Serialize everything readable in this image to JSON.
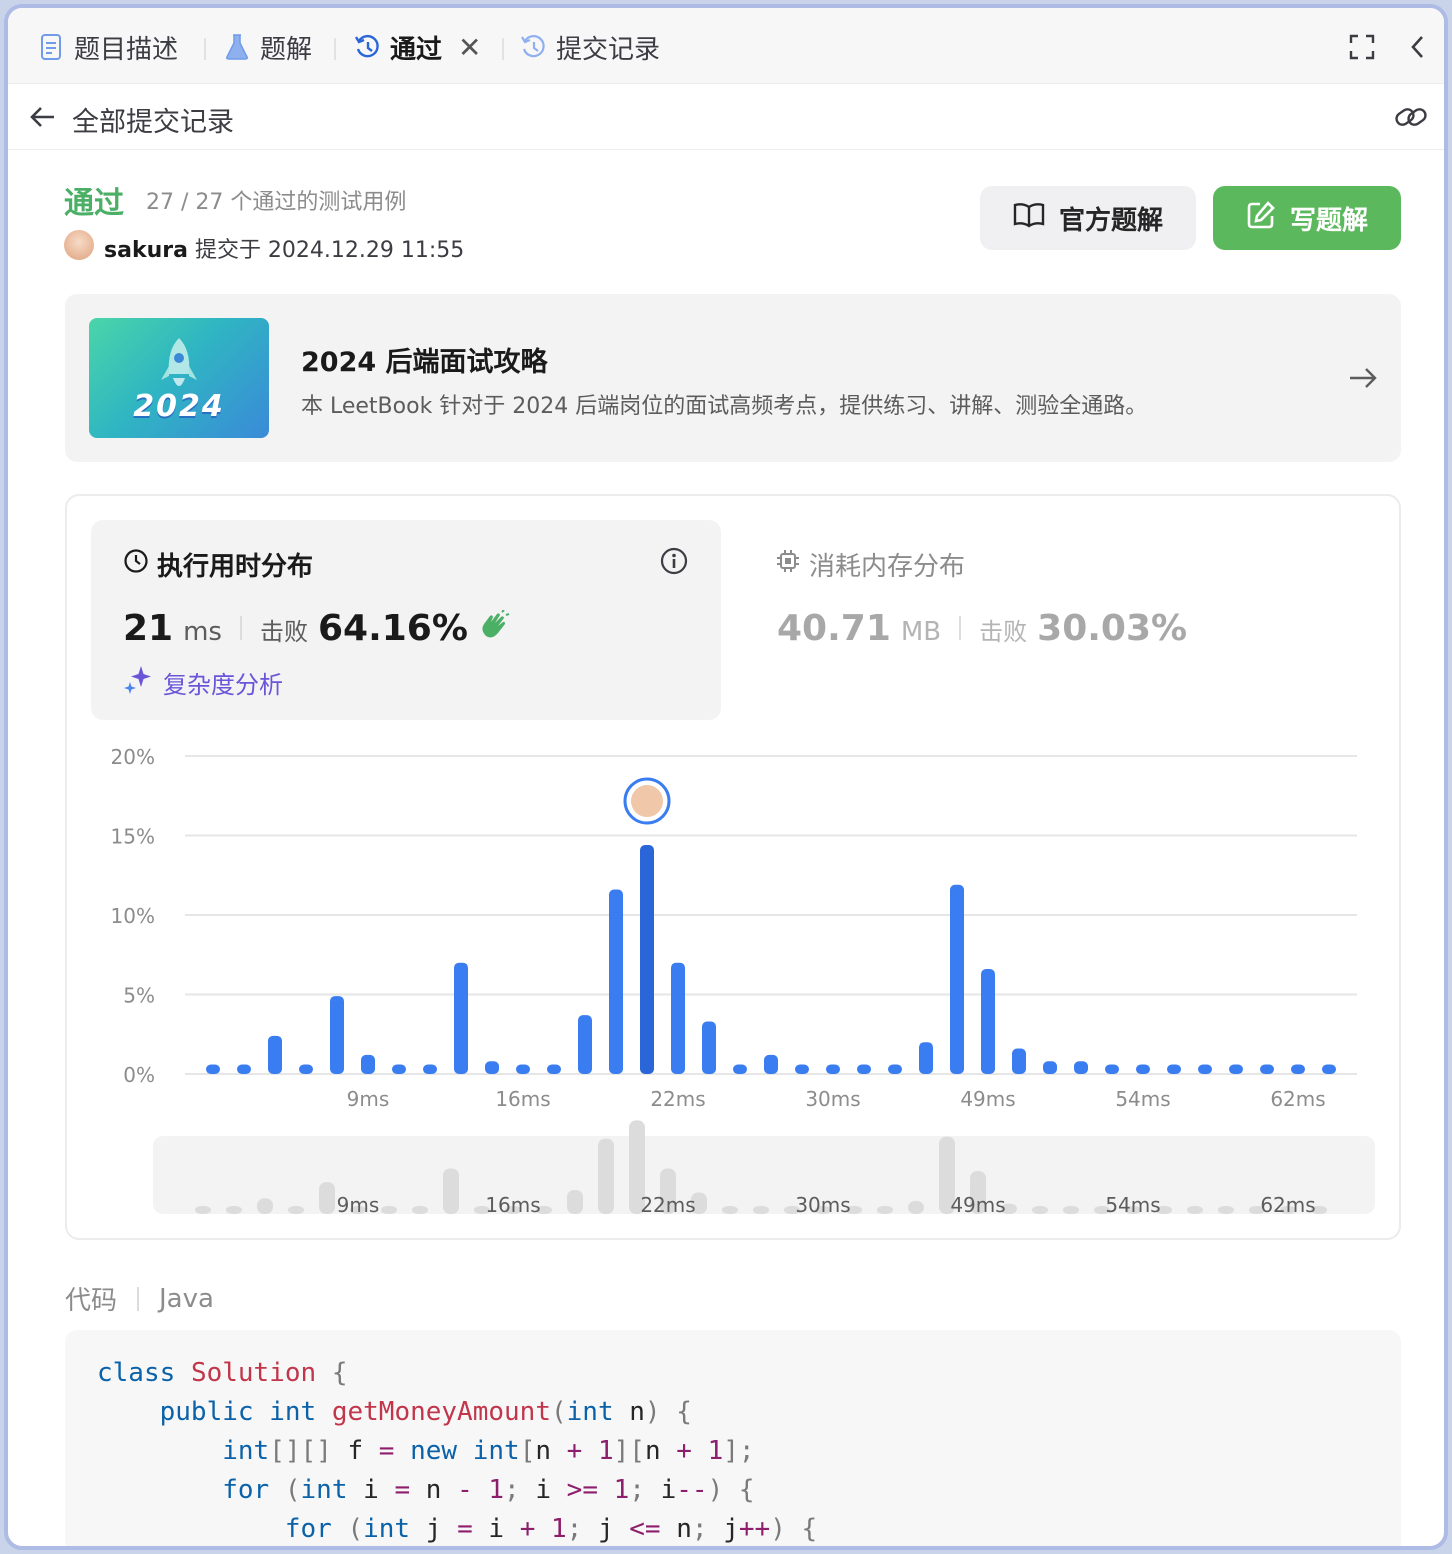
{
  "tabs": [
    {
      "label": "题目描述",
      "icon": "document-icon"
    },
    {
      "label": "题解",
      "icon": "flask-icon"
    },
    {
      "label": "通过",
      "icon": "history-icon",
      "active": true,
      "closable": true
    },
    {
      "label": "提交记录",
      "icon": "history-icon"
    }
  ],
  "header": {
    "title": "全部提交记录"
  },
  "submission": {
    "status": "通过",
    "testcases": "27 / 27 个通过的测试用例",
    "user": "sakura",
    "submitted_at": "提交于 2024.12.29 11:55"
  },
  "buttons": {
    "official": "官方题解",
    "write": "写题解"
  },
  "leetbook": {
    "cover_text": "2024",
    "title": "2024 后端面试攻略",
    "desc": "本 LeetBook 针对于 2024 后端岗位的面试高频考点，提供练习、讲解、测验全通路。"
  },
  "runtime": {
    "title": "执行用时分布",
    "value": "21",
    "unit": "ms",
    "beat_label": "击败",
    "beat": "64.16%",
    "complexity": "复杂度分析"
  },
  "memory": {
    "title": "消耗内存分布",
    "value": "40.71",
    "unit": "MB",
    "beat_label": "击败",
    "beat": "30.03%"
  },
  "chart_data": {
    "type": "bar",
    "ylabel": "",
    "xlabel": "",
    "ylim": [
      0,
      20
    ],
    "yticks": [
      "0%",
      "5%",
      "10%",
      "15%",
      "20%"
    ],
    "xticks": [
      "9ms",
      "16ms",
      "22ms",
      "30ms",
      "49ms",
      "54ms",
      "62ms"
    ],
    "values": [
      0.6,
      0.6,
      2.4,
      0.6,
      4.9,
      1.2,
      0.6,
      0.6,
      7.0,
      0.8,
      0.6,
      0.6,
      3.7,
      11.6,
      14.4,
      7.0,
      3.3,
      0.6,
      1.2,
      0.6,
      0.6,
      0.6,
      0.6,
      2.0,
      11.9,
      6.6,
      1.6,
      0.8,
      0.8,
      0.6,
      0.6,
      0.6,
      0.6,
      0.6,
      0.6,
      0.6,
      0.6
    ],
    "highlight_index": 14,
    "bar_color": "#3a7df0",
    "highlight_color": "#2b66d9",
    "grid": true
  },
  "code": {
    "label": "代码",
    "language": "Java"
  },
  "colors": {
    "accepted": "#4caf66",
    "accent": "#3a7df0",
    "complexity": "#6a55d9"
  }
}
